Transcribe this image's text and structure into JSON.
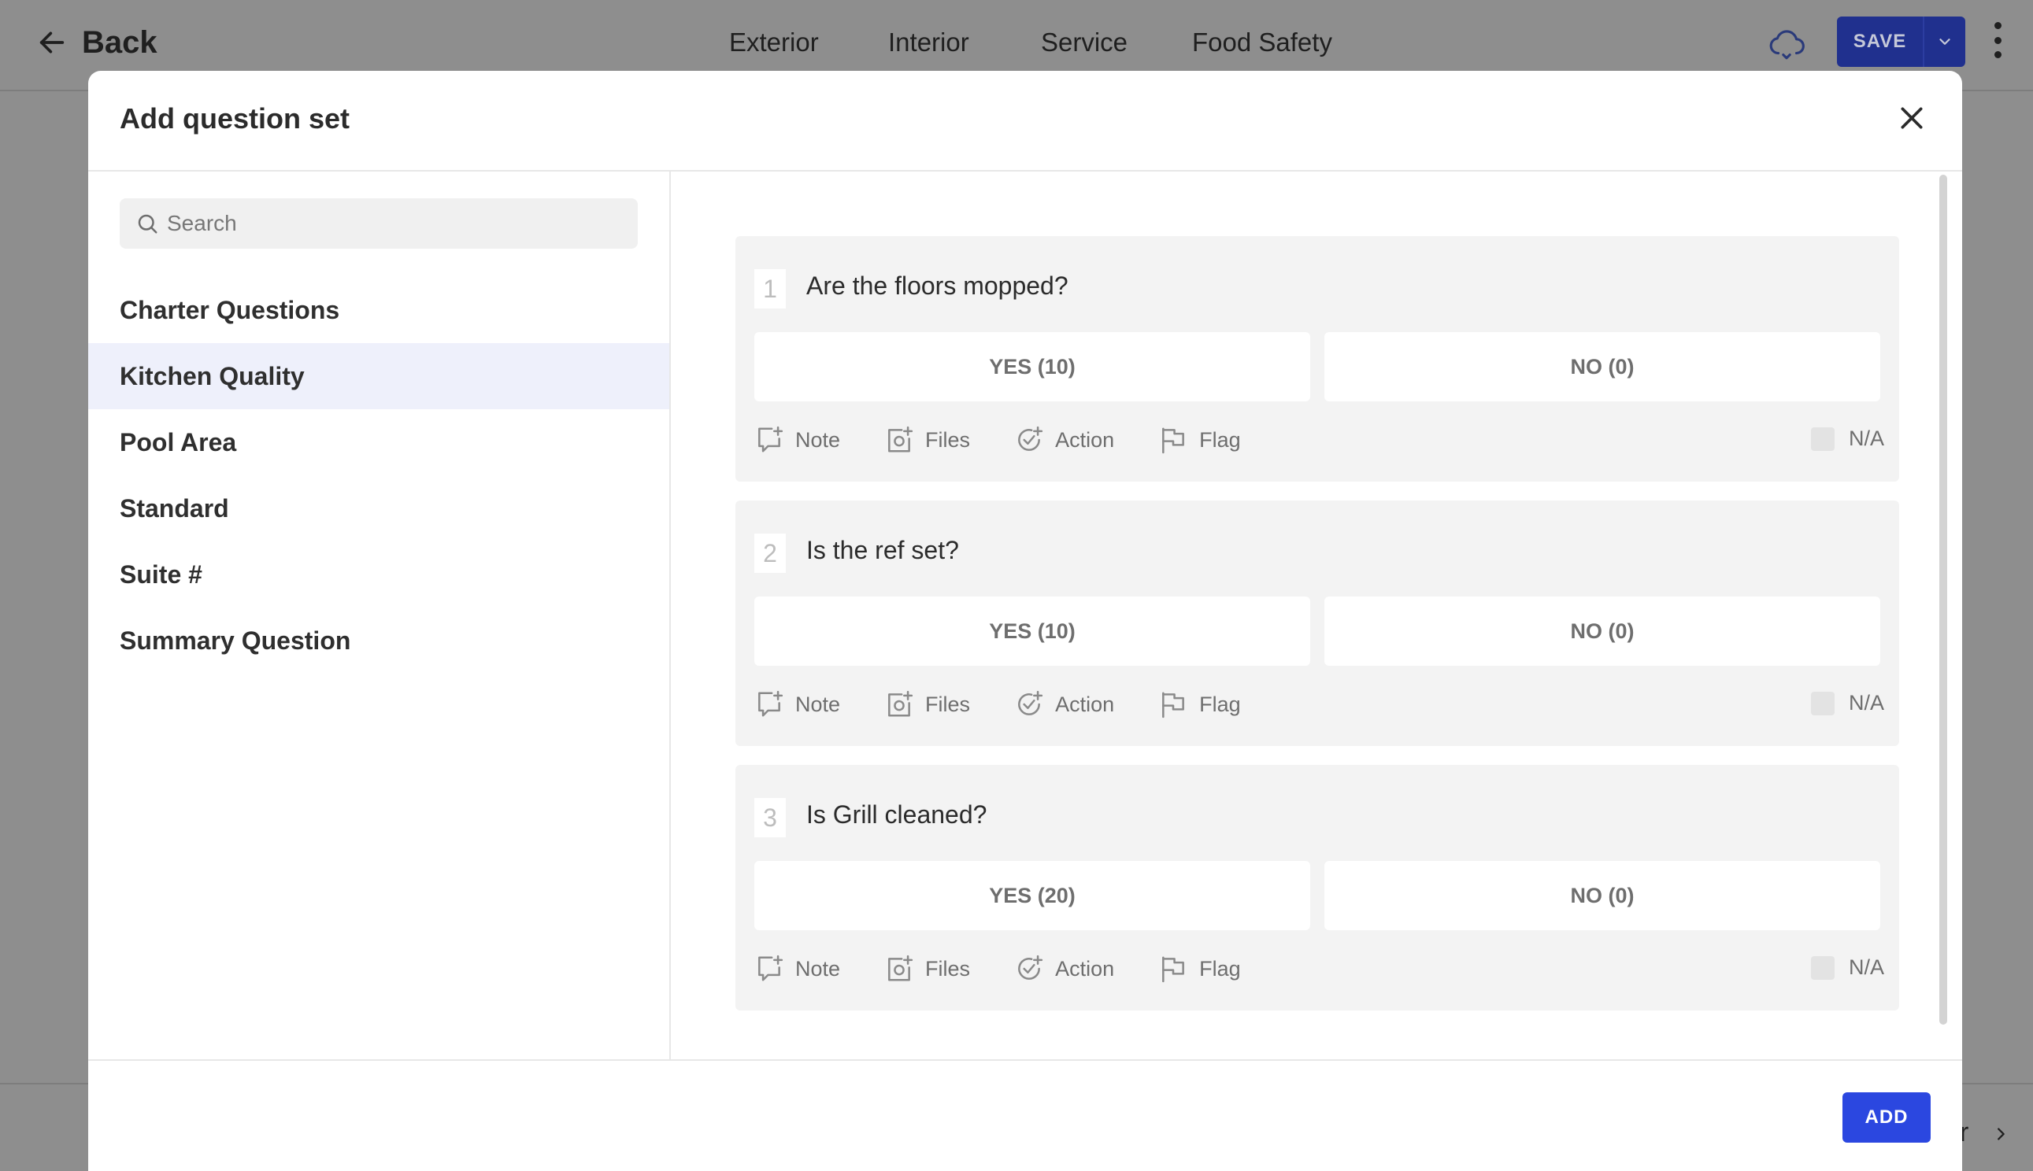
{
  "topbar": {
    "back_label": "Back",
    "tabs": [
      "Exterior",
      "Interior",
      "Service",
      "Food Safety"
    ],
    "save_label": "SAVE"
  },
  "bottom_peek_text": "r",
  "modal": {
    "title": "Add question set",
    "search_placeholder": "Search",
    "question_sets": [
      {
        "label": "Charter Questions",
        "active": false
      },
      {
        "label": "Kitchen Quality",
        "active": true
      },
      {
        "label": "Pool Area",
        "active": false
      },
      {
        "label": "Standard",
        "active": false
      },
      {
        "label": "Suite #",
        "active": false
      },
      {
        "label": "Summary Question",
        "active": false
      }
    ],
    "questions": [
      {
        "number": "1",
        "text": "Are the floors mopped?",
        "yes_label": "YES (10)",
        "no_label": "NO (0)"
      },
      {
        "number": "2",
        "text": "Is the ref set?",
        "yes_label": "YES (10)",
        "no_label": "NO (0)"
      },
      {
        "number": "3",
        "text": "Is Grill cleaned?",
        "yes_label": "YES (20)",
        "no_label": "NO (0)"
      }
    ],
    "tools": {
      "note": "Note",
      "files": "Files",
      "action": "Action",
      "flag": "Flag",
      "na": "N/A"
    },
    "add_label": "ADD"
  },
  "colors": {
    "primary": "#2b47e0",
    "overlay_bg": "#8e8e8e",
    "active_item_bg": "#eef0fb",
    "card_bg": "#f3f3f3"
  },
  "icons": [
    "back-arrow-icon",
    "cloud-sync-icon",
    "chevron-down-icon",
    "more-vertical-icon",
    "close-icon",
    "search-icon",
    "note-icon",
    "files-icon",
    "action-icon",
    "flag-icon",
    "chevron-right-icon"
  ]
}
